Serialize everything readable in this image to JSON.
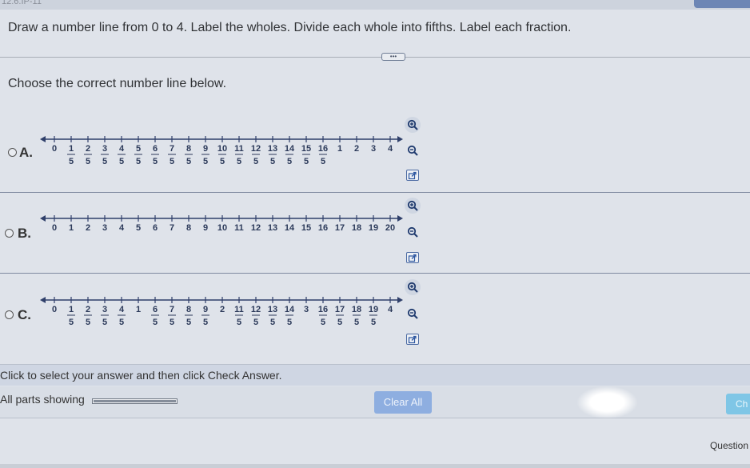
{
  "header": {
    "crumb": "12.6.IP-11"
  },
  "instruction": "Draw a number line from 0 to 4. Label the wholes. Divide each whole into fifths. Label each fraction.",
  "more_button": "•••",
  "prompt": "Choose the correct number line below.",
  "options": [
    {
      "label": "A.",
      "marks": [
        {
          "num": "0"
        },
        {
          "num": "1",
          "den": "5"
        },
        {
          "num": "2",
          "den": "5"
        },
        {
          "num": "3",
          "den": "5"
        },
        {
          "num": "4",
          "den": "5"
        },
        {
          "num": "5",
          "den": "5"
        },
        {
          "num": "6",
          "den": "5"
        },
        {
          "num": "7",
          "den": "5"
        },
        {
          "num": "8",
          "den": "5"
        },
        {
          "num": "9",
          "den": "5"
        },
        {
          "num": "10",
          "den": "5"
        },
        {
          "num": "11",
          "den": "5"
        },
        {
          "num": "12",
          "den": "5"
        },
        {
          "num": "13",
          "den": "5"
        },
        {
          "num": "14",
          "den": "5"
        },
        {
          "num": "15",
          "den": "5"
        },
        {
          "num": "16",
          "den": "5"
        },
        {
          "num": "1"
        },
        {
          "num": "2"
        },
        {
          "num": "3"
        },
        {
          "num": "4"
        }
      ]
    },
    {
      "label": "B.",
      "marks": [
        {
          "num": "0"
        },
        {
          "num": "1"
        },
        {
          "num": "2"
        },
        {
          "num": "3"
        },
        {
          "num": "4"
        },
        {
          "num": "5"
        },
        {
          "num": "6"
        },
        {
          "num": "7"
        },
        {
          "num": "8"
        },
        {
          "num": "9"
        },
        {
          "num": "10"
        },
        {
          "num": "11"
        },
        {
          "num": "12"
        },
        {
          "num": "13"
        },
        {
          "num": "14"
        },
        {
          "num": "15"
        },
        {
          "num": "16"
        },
        {
          "num": "17"
        },
        {
          "num": "18"
        },
        {
          "num": "19"
        },
        {
          "num": "20"
        }
      ]
    },
    {
      "label": "C.",
      "marks": [
        {
          "num": "0"
        },
        {
          "num": "1",
          "den": "5"
        },
        {
          "num": "2",
          "den": "5"
        },
        {
          "num": "3",
          "den": "5"
        },
        {
          "num": "4",
          "den": "5"
        },
        {
          "num": "1"
        },
        {
          "num": "6",
          "den": "5"
        },
        {
          "num": "7",
          "den": "5"
        },
        {
          "num": "8",
          "den": "5"
        },
        {
          "num": "9",
          "den": "5"
        },
        {
          "num": "2"
        },
        {
          "num": "11",
          "den": "5"
        },
        {
          "num": "12",
          "den": "5"
        },
        {
          "num": "13",
          "den": "5"
        },
        {
          "num": "14",
          "den": "5"
        },
        {
          "num": "3"
        },
        {
          "num": "16",
          "den": "5"
        },
        {
          "num": "17",
          "den": "5"
        },
        {
          "num": "18",
          "den": "5"
        },
        {
          "num": "19",
          "den": "5"
        },
        {
          "num": "4"
        }
      ]
    }
  ],
  "icons": {
    "zoom_in": "zoom-in-icon",
    "zoom_out": "zoom-out-icon",
    "pop_out": "pop-out-icon"
  },
  "status_text": "Click to select your answer and then click Check Answer.",
  "parts_label": "All parts showing",
  "parts_progress": 1.0,
  "clear_all_label": "Clear All",
  "check_answer_label": "Ch",
  "question_label": "Question",
  "colors": {
    "accent_blue": "#8eaee0",
    "check_blue": "#7fc6e6",
    "line_color": "#2f3f6a"
  }
}
